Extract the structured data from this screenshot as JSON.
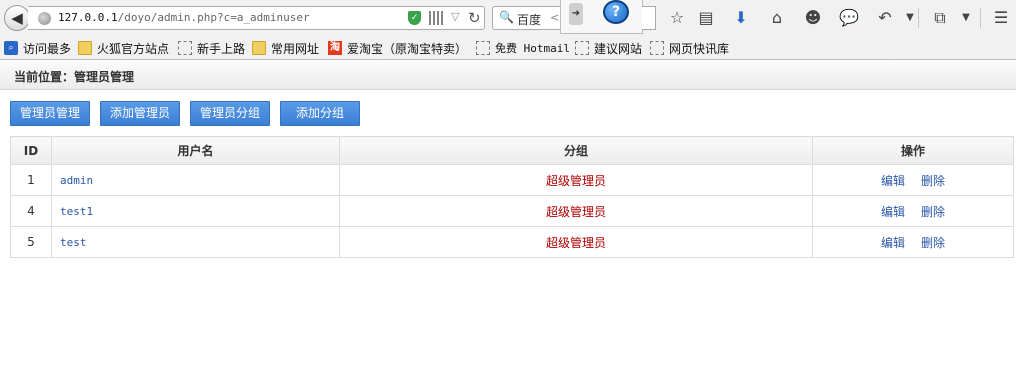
{
  "browser": {
    "url_host": "127.0.0.1",
    "url_path": "/doyo/admin.php?c=a_adminuser",
    "search_engine": "百度",
    "search_extra": "<"
  },
  "bookmarks": [
    {
      "label": "访问最多",
      "icon": "search-icon"
    },
    {
      "label": "火狐官方站点",
      "icon": "folder-icon"
    },
    {
      "label": "新手上路",
      "icon": "page-icon"
    },
    {
      "label": "常用网址",
      "icon": "folder-icon"
    },
    {
      "label": "爱淘宝（原淘宝特卖）",
      "icon": "taobao-icon",
      "icon_text": "淘"
    },
    {
      "label": "免费 Hotmail",
      "icon": "page-icon"
    },
    {
      "label": "建议网站",
      "icon": "page-icon"
    },
    {
      "label": "网页快讯库",
      "icon": "page-icon"
    }
  ],
  "page": {
    "breadcrumb": "当前位置：管理员管理",
    "buttons": [
      "管理员管理",
      "添加管理员",
      "管理员分组",
      "添加分组"
    ],
    "table": {
      "headers": [
        "ID",
        "用户名",
        "分组",
        "操作"
      ],
      "rows": [
        {
          "id": "1",
          "username": "admin",
          "group": "超级管理员",
          "edit": "编辑",
          "delete": "删除"
        },
        {
          "id": "4",
          "username": "test1",
          "group": "超级管理员",
          "edit": "编辑",
          "delete": "删除"
        },
        {
          "id": "5",
          "username": "test",
          "group": "超级管理员",
          "edit": "编辑",
          "delete": "删除"
        }
      ]
    }
  },
  "colors": {
    "button_blue": "#4a8de0",
    "link_blue": "#2a56a6",
    "group_red": "#b00000"
  }
}
